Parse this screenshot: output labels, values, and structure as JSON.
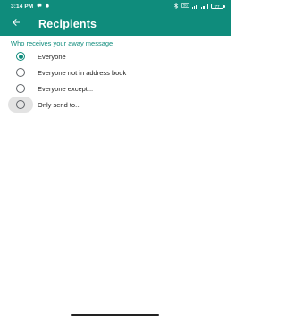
{
  "status_bar": {
    "time": "3:14 PM",
    "left_icons": [
      "sms-icon",
      "app-notification-icon"
    ],
    "right_icons": [
      "bluetooth-icon",
      "volte-icon",
      "wifi-signal-icon",
      "cell-signal-icon",
      "battery-icon"
    ],
    "battery_level": "77"
  },
  "app_bar": {
    "title": "Recipients",
    "back_icon": "arrow-left-icon",
    "color": "#0f8c7c"
  },
  "section": {
    "header": "Who receives your away message"
  },
  "options": [
    {
      "label": "Everyone",
      "selected": true
    },
    {
      "label": "Everyone not in address book",
      "selected": false
    },
    {
      "label": "Everyone except...",
      "selected": false
    },
    {
      "label": "Only send to...",
      "selected": false
    }
  ]
}
